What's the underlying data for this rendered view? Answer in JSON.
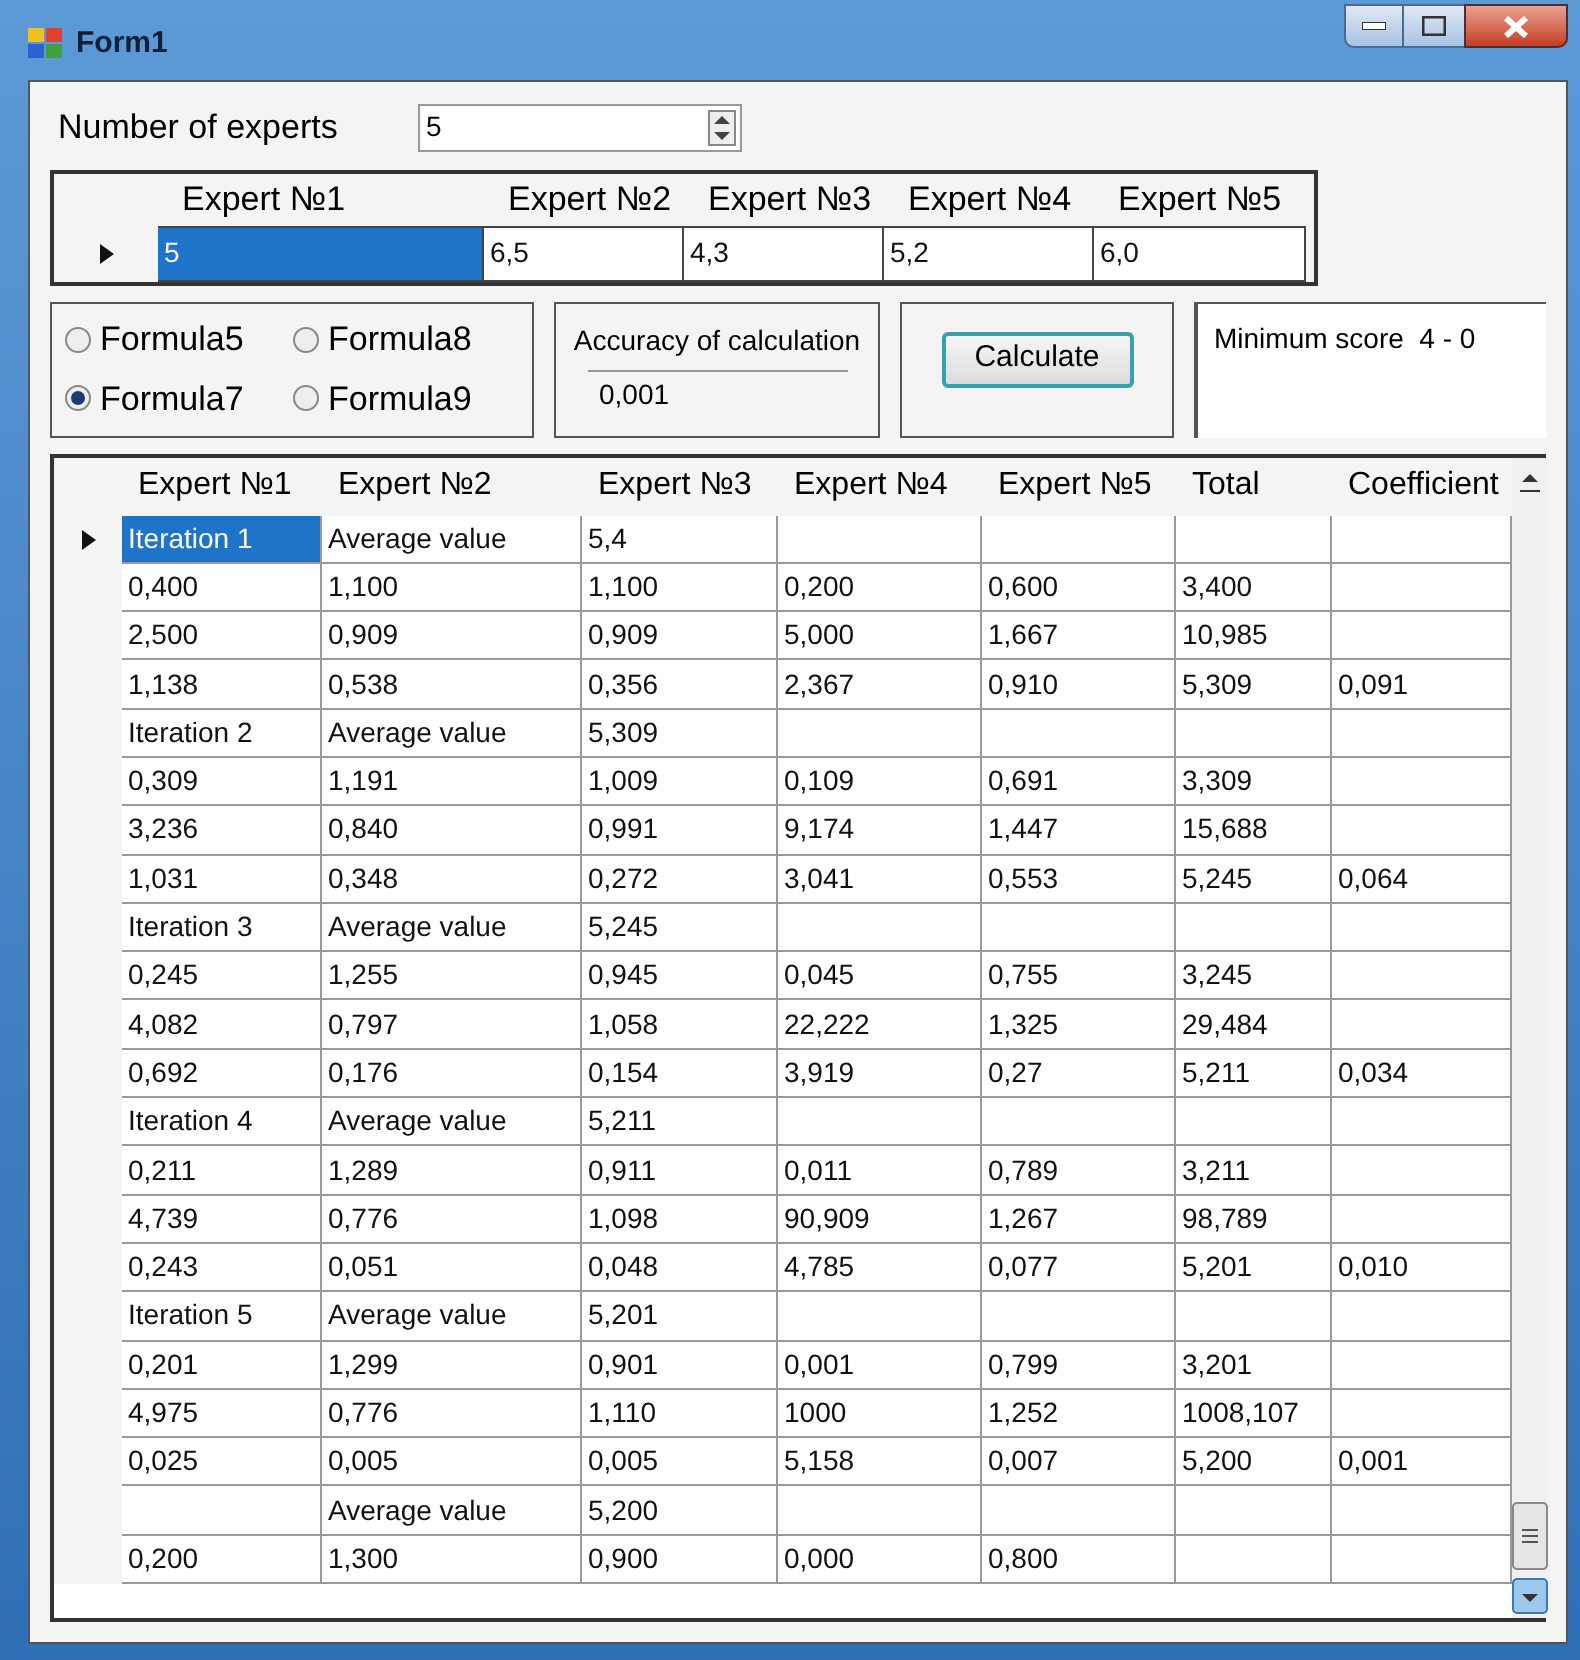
{
  "window": {
    "title": "Form1"
  },
  "experts_count": {
    "label": "Number of experts",
    "value": "5"
  },
  "input_grid": {
    "columns": [
      "Expert №1",
      "Expert №2",
      "Expert №3",
      "Expert №4",
      "Expert №5"
    ],
    "rows": [
      {
        "selected": true,
        "first_cell_selected": true,
        "cells": [
          "5",
          "6,5",
          "4,3",
          "5,2",
          "6,0"
        ]
      }
    ]
  },
  "formulas": [
    {
      "label": "Formula5",
      "selected": false
    },
    {
      "label": "Formula8",
      "selected": false
    },
    {
      "label": "Formula7",
      "selected": true
    },
    {
      "label": "Formula9",
      "selected": false
    }
  ],
  "accuracy": {
    "label": "Accuracy of calculation",
    "value": "0,001"
  },
  "calculate_button": "Calculate",
  "minimum_score": "Minimum score  4 - 0",
  "results_grid": {
    "columns": [
      "Expert  №1",
      "Expert №2",
      "Expert №3",
      "Expert №4",
      "Expert №5",
      "Total",
      "Coefficient"
    ],
    "rows": [
      {
        "selected": true,
        "first_cell_selected": true,
        "cells": [
          "Iteration 1",
          "Average value",
          "5,4",
          null,
          null,
          null,
          null
        ]
      },
      {
        "selected": false,
        "first_cell_selected": false,
        "cells": [
          "0,400",
          "1,100",
          "1,100",
          "0,200",
          "0,600",
          "3,400",
          null
        ]
      },
      {
        "selected": false,
        "first_cell_selected": false,
        "cells": [
          "2,500",
          "0,909",
          "0,909",
          "5,000",
          "1,667",
          "10,985",
          null
        ]
      },
      {
        "selected": false,
        "first_cell_selected": false,
        "cells": [
          "1,138",
          "0,538",
          "0,356",
          "2,367",
          "0,910",
          "5,309",
          "0,091"
        ]
      },
      {
        "selected": false,
        "first_cell_selected": false,
        "cells": [
          "Iteration 2",
          "Average value",
          "5,309",
          null,
          null,
          null,
          null
        ]
      },
      {
        "selected": false,
        "first_cell_selected": false,
        "cells": [
          "0,309",
          "1,191",
          "1,009",
          "0,109",
          "0,691",
          "3,309",
          null
        ]
      },
      {
        "selected": false,
        "first_cell_selected": false,
        "cells": [
          "3,236",
          "0,840",
          "0,991",
          "9,174",
          "1,447",
          "15,688",
          null
        ]
      },
      {
        "selected": false,
        "first_cell_selected": false,
        "cells": [
          "1,031",
          "0,348",
          "0,272",
          "3,041",
          "0,553",
          "5,245",
          "0,064"
        ]
      },
      {
        "selected": false,
        "first_cell_selected": false,
        "cells": [
          "Iteration 3",
          "Average value",
          "5,245",
          null,
          null,
          null,
          null
        ]
      },
      {
        "selected": false,
        "first_cell_selected": false,
        "cells": [
          "0,245",
          "1,255",
          "0,945",
          "0,045",
          "0,755",
          "3,245",
          null
        ]
      },
      {
        "selected": false,
        "first_cell_selected": false,
        "cells": [
          "4,082",
          "0,797",
          "1,058",
          "22,222",
          "1,325",
          "29,484",
          null
        ]
      },
      {
        "selected": false,
        "first_cell_selected": false,
        "cells": [
          "0,692",
          "0,176",
          "0,154",
          "3,919",
          "0,27",
          "5,211",
          "0,034"
        ]
      },
      {
        "selected": false,
        "first_cell_selected": false,
        "cells": [
          "Iteration 4",
          "Average value",
          "5,211",
          null,
          null,
          null,
          null
        ]
      },
      {
        "selected": false,
        "first_cell_selected": false,
        "cells": [
          "0,211",
          "1,289",
          "0,911",
          "0,011",
          "0,789",
          "3,211",
          null
        ]
      },
      {
        "selected": false,
        "first_cell_selected": false,
        "cells": [
          "4,739",
          "0,776",
          "1,098",
          "90,909",
          "1,267",
          "98,789",
          null
        ]
      },
      {
        "selected": false,
        "first_cell_selected": false,
        "cells": [
          "0,243",
          "0,051",
          "0,048",
          "4,785",
          "0,077",
          "5,201",
          "0,010"
        ]
      },
      {
        "selected": false,
        "first_cell_selected": false,
        "cells": [
          "Iteration 5",
          "Average value",
          "5,201",
          null,
          null,
          null,
          null
        ]
      },
      {
        "selected": false,
        "first_cell_selected": false,
        "cells": [
          "0,201",
          "1,299",
          "0,901",
          "0,001",
          "0,799",
          "3,201",
          null
        ]
      },
      {
        "selected": false,
        "first_cell_selected": false,
        "cells": [
          "4,975",
          "0,776",
          "1,110",
          "1000",
          "1,252",
          "1008,107",
          null
        ]
      },
      {
        "selected": false,
        "first_cell_selected": false,
        "cells": [
          "0,025",
          "0,005",
          "0,005",
          "5,158",
          "0,007",
          "5,200",
          "0,001"
        ]
      },
      {
        "selected": false,
        "first_cell_selected": false,
        "cells": [
          null,
          "Average value",
          "5,200",
          null,
          null,
          null,
          null
        ]
      },
      {
        "selected": false,
        "first_cell_selected": false,
        "cells": [
          "0,200",
          "1,300",
          "0,900",
          "0,000",
          "0,800",
          null,
          null
        ]
      }
    ]
  }
}
